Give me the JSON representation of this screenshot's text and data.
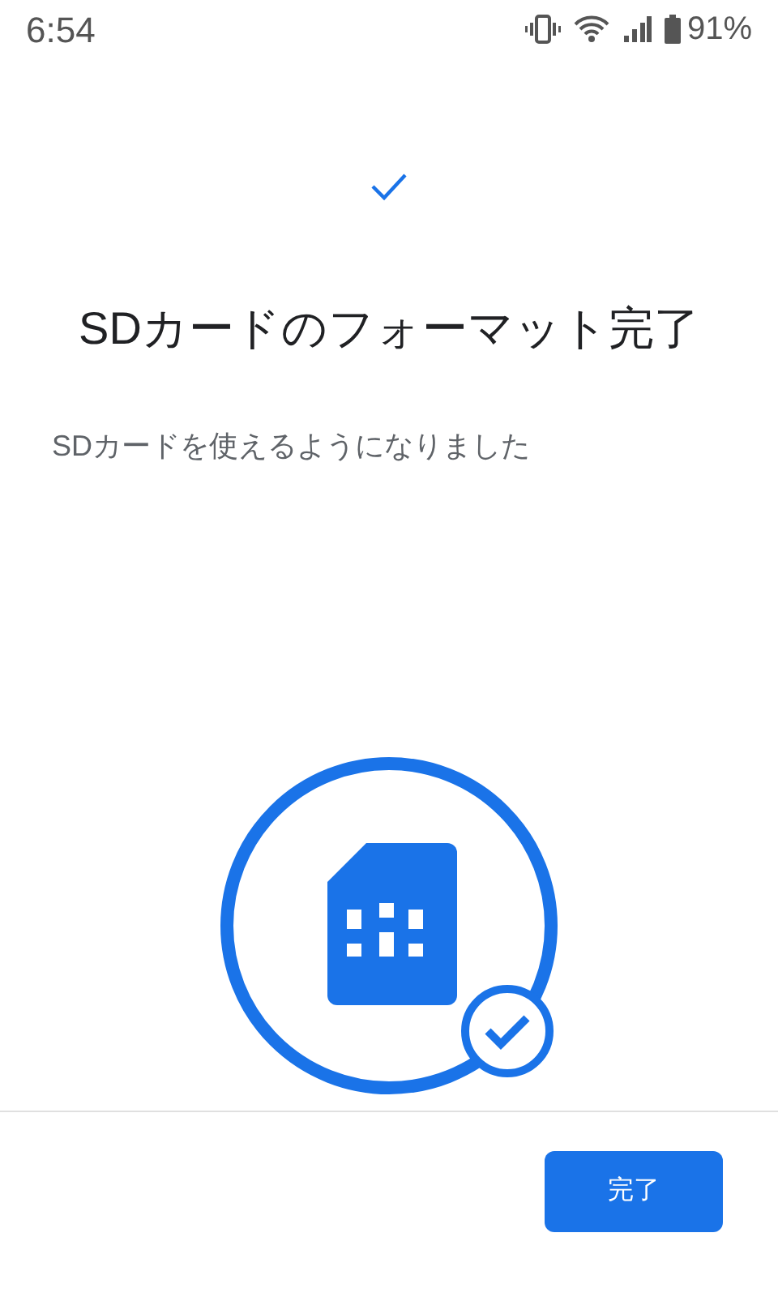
{
  "status_bar": {
    "time": "6:54",
    "battery": "91%"
  },
  "title": "SDカードのフォーマット完了",
  "subtitle": "SDカードを使えるようになりました",
  "buttons": [
    "完了"
  ]
}
